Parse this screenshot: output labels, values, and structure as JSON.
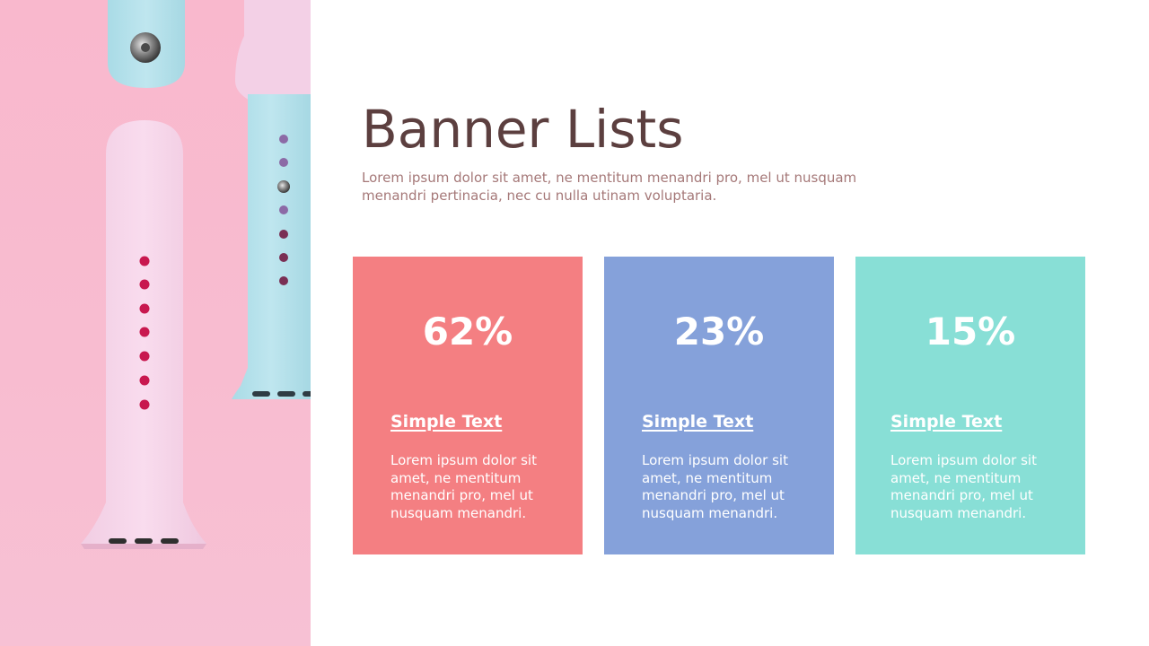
{
  "slide": {
    "title": "Banner Lists",
    "subtitle": "Lorem ipsum dolor sit amet, ne mentitum menandri pro, mel ut nusquam menandri pertinacia, nec cu nulla utinam voluptaria.",
    "colors": {
      "title": "#5c3f3f",
      "subtitle": "#a57878",
      "photo_background": "#f9b8cd"
    }
  },
  "photo": {
    "subject": "pink and blue watch bands"
  },
  "cards": [
    {
      "value": "62%",
      "heading": "Simple Text",
      "body": "Lorem ipsum dolor sit amet, ne mentitum menandri pro, mel ut nusquam menandri.",
      "color": "#f47f82"
    },
    {
      "value": "23%",
      "heading": "Simple Text",
      "body": "Lorem ipsum dolor sit amet, ne mentitum menandri pro, mel ut nusquam menandri.",
      "color": "#85a1da"
    },
    {
      "value": "15%",
      "heading": "Simple Text",
      "body": "Lorem ipsum dolor sit amet, ne mentitum menandri pro, mel ut nusquam menandri.",
      "color": "#88dfd6"
    }
  ]
}
